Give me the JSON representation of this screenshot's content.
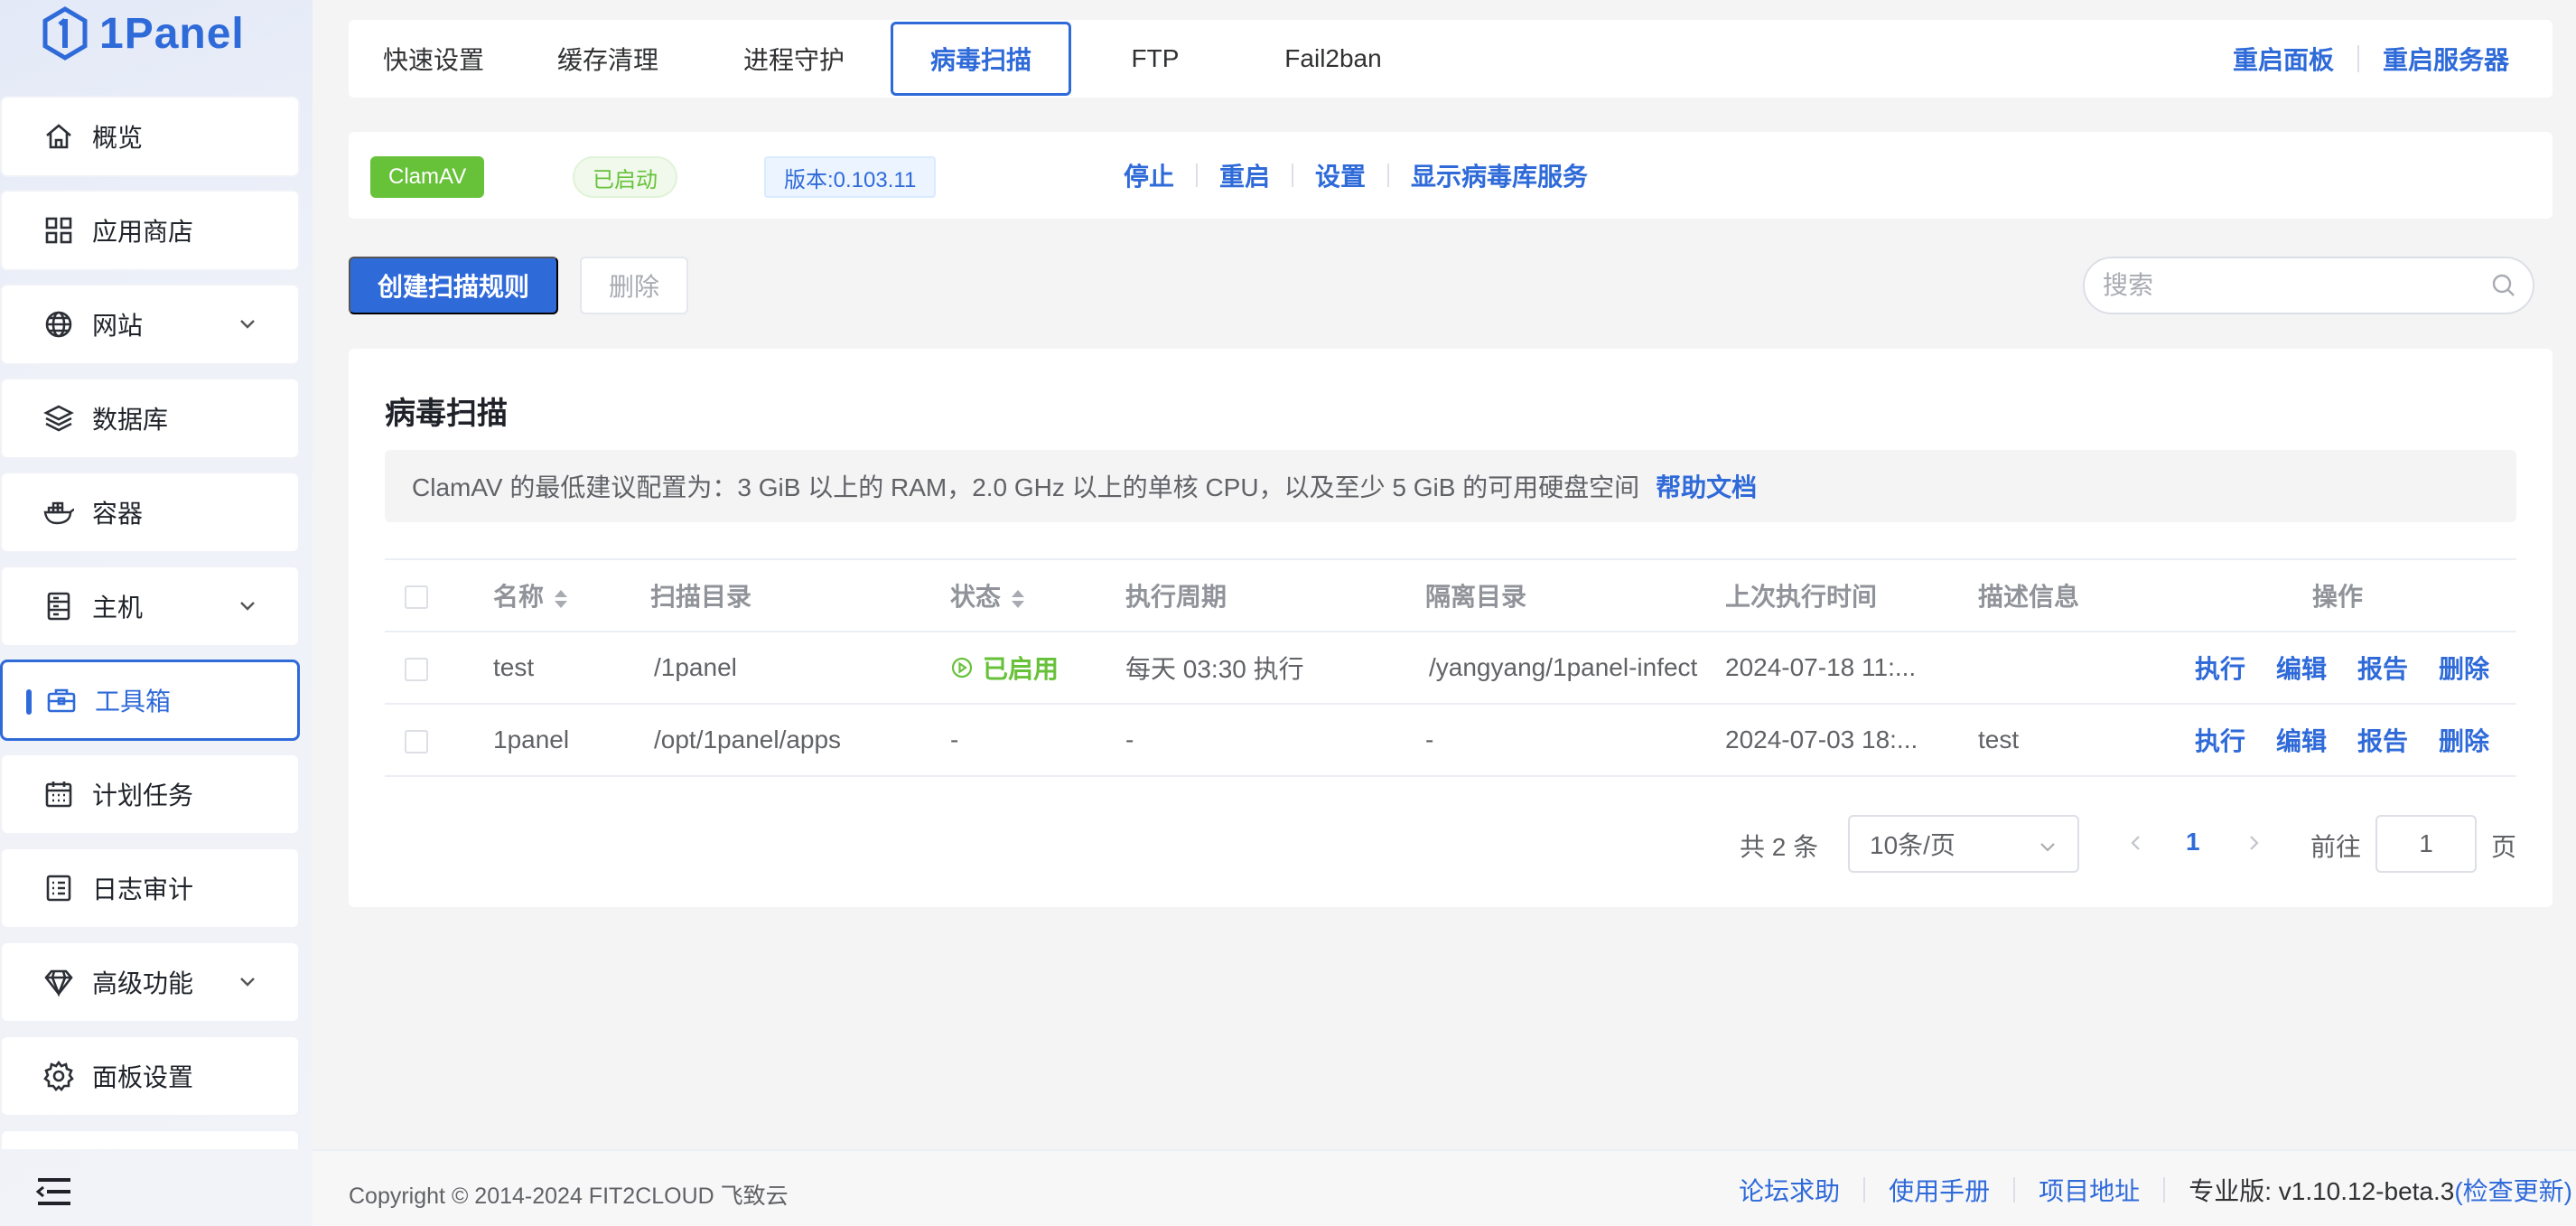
{
  "app": {
    "logo_text": "1Panel"
  },
  "sidebar": {
    "items": [
      {
        "label": "概览",
        "icon": "home-icon"
      },
      {
        "label": "应用商店",
        "icon": "grid-icon"
      },
      {
        "label": "网站",
        "icon": "globe-icon",
        "has_children": true
      },
      {
        "label": "数据库",
        "icon": "layers-icon"
      },
      {
        "label": "容器",
        "icon": "docker-icon"
      },
      {
        "label": "主机",
        "icon": "server-icon",
        "has_children": true
      },
      {
        "label": "工具箱",
        "icon": "toolbox-icon",
        "active": true
      },
      {
        "label": "计划任务",
        "icon": "calendar-icon"
      },
      {
        "label": "日志审计",
        "icon": "log-icon"
      },
      {
        "label": "高级功能",
        "icon": "diamond-icon",
        "has_children": true
      },
      {
        "label": "面板设置",
        "icon": "gear-icon"
      }
    ]
  },
  "tabs": [
    {
      "label": "快速设置"
    },
    {
      "label": "缓存清理"
    },
    {
      "label": "进程守护"
    },
    {
      "label": "病毒扫描",
      "active": true
    },
    {
      "label": "FTP"
    },
    {
      "label": "Fail2ban"
    }
  ],
  "top_actions": {
    "restart_panel": "重启面板",
    "restart_server": "重启服务器"
  },
  "service": {
    "name": "ClamAV",
    "status": "已启动",
    "version": "版本:0.103.11",
    "actions": {
      "stop": "停止",
      "restart": "重启",
      "settings": "设置",
      "show_db_service": "显示病毒库服务"
    }
  },
  "toolbar": {
    "create_label": "创建扫描规则",
    "delete_label": "删除",
    "search_placeholder": "搜索"
  },
  "main": {
    "title": "病毒扫描",
    "notice": "ClamAV 的最低建议配置为：3 GiB 以上的 RAM，2.0 GHz 以上的单核 CPU，以及至少 5 GiB 的可用硬盘空间",
    "notice_link": "帮助文档"
  },
  "table": {
    "columns": {
      "name": "名称",
      "scan_dir": "扫描目录",
      "status": "状态",
      "cycle": "执行周期",
      "infected_dir": "隔离目录",
      "last_exec": "上次执行时间",
      "description": "描述信息",
      "ops": "操作"
    },
    "rows": [
      {
        "name": "test",
        "scan_dir": "/1panel",
        "status": "已启用",
        "cycle": "每天 03:30 执行",
        "infected_dir": "/yangyang/1panel-infect",
        "last_exec": "2024-07-18 11:...",
        "description": "",
        "ops": {
          "exec": "执行",
          "edit": "编辑",
          "report": "报告",
          "delete": "删除"
        }
      },
      {
        "name": "1panel",
        "scan_dir": "/opt/1panel/apps",
        "status": "-",
        "cycle": "-",
        "infected_dir": "-",
        "last_exec": "2024-07-03 18:...",
        "description": "test",
        "ops": {
          "exec": "执行",
          "edit": "编辑",
          "report": "报告",
          "delete": "删除"
        }
      }
    ]
  },
  "pagination": {
    "total": "共 2 条",
    "page_size": "10条/页",
    "current_page": "1",
    "goto_label": "前往",
    "goto_value": "1",
    "page_unit": "页"
  },
  "footer": {
    "copyright": "Copyright © 2014-2024 FIT2CLOUD 飞致云",
    "forum": "论坛求助",
    "manual": "使用手册",
    "project": "项目地址",
    "edition_label": "专业版:",
    "version": "v1.10.12-beta.3",
    "check_update": "(检查更新)"
  },
  "colors": {
    "primary": "#2f6ad9",
    "success": "#67c23a",
    "border": "#dcdfe6"
  }
}
